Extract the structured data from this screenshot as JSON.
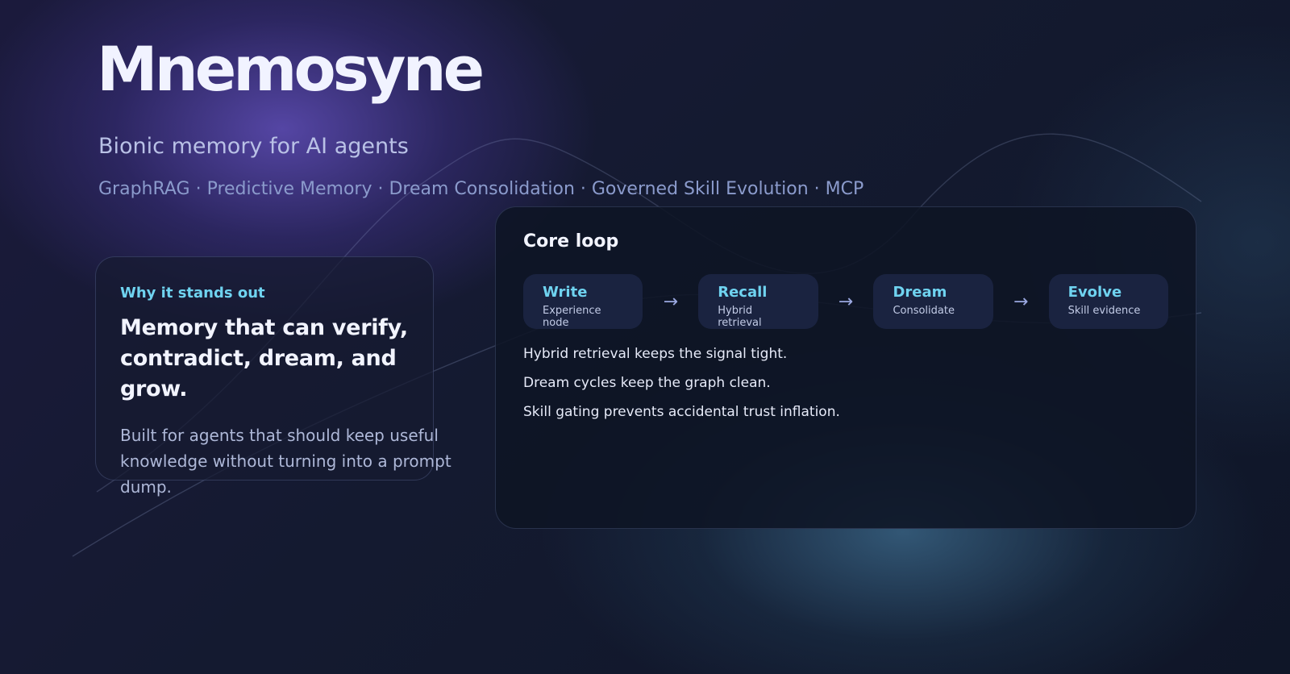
{
  "hero": {
    "title": "Mnemosyne",
    "subtitle": "Bionic memory for AI agents",
    "features": "GraphRAG · Predictive Memory · Dream Consolidation · Governed Skill Evolution · MCP"
  },
  "why_card": {
    "eyebrow": "Why it stands out",
    "headline_line1": "Memory that can verify,",
    "headline_line2": "contradict, dream, and grow.",
    "body": "Built for agents that should keep useful knowledge without turning into a prompt dump."
  },
  "core_loop": {
    "title": "Core loop",
    "arrow": "→",
    "steps": [
      {
        "title": "Write",
        "subtitle": "Experience node"
      },
      {
        "title": "Recall",
        "subtitle": "Hybrid retrieval"
      },
      {
        "title": "Dream",
        "subtitle": "Consolidate"
      },
      {
        "title": "Evolve",
        "subtitle": "Skill evidence"
      }
    ],
    "points": [
      "Hybrid retrieval keeps the signal tight.",
      "Dream cycles keep the graph clean.",
      "Skill gating prevents accidental trust inflation."
    ]
  },
  "colors": {
    "accent": "#6fd3f0",
    "title": "#f1f3ff",
    "card_background": "#0e1424",
    "step_background": "#1a2340"
  }
}
